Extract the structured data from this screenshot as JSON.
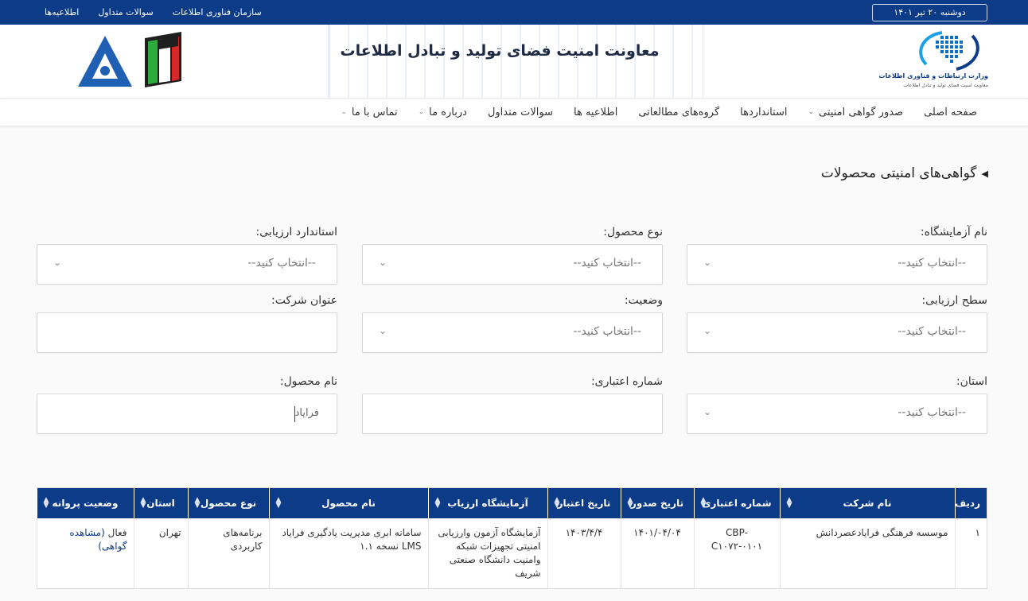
{
  "topbar": {
    "date": "دوشنبه ۲۰ تیر ۱۴۰۱",
    "links": [
      "اطلاعیه‌ها",
      "سوالات متداول",
      "سازمان فناوری اطلاعات"
    ]
  },
  "header": {
    "banner_title": "معاونت امنیت فضای تولید و تبادل اطلاعات",
    "ministry_name": "وزارت ارتباطات و فناوری اطلاعات",
    "ministry_sub": "معاونت امنیت فضای تولید و تبادل اطلاعات"
  },
  "nav": {
    "items": [
      {
        "label": "صفحه اصلی",
        "dropdown": false
      },
      {
        "label": "صدور گواهی امنیتی",
        "dropdown": true
      },
      {
        "label": "استانداردها",
        "dropdown": false
      },
      {
        "label": "گروه‌های مطالعاتی",
        "dropdown": false
      },
      {
        "label": "اطلاعیه ها",
        "dropdown": false
      },
      {
        "label": "سوالات متداول",
        "dropdown": false
      },
      {
        "label": "درباره ما",
        "dropdown": true
      },
      {
        "label": "تماس با ما",
        "dropdown": true
      }
    ]
  },
  "page": {
    "title": "گواهی‌های امنیتی محصولات"
  },
  "form": {
    "select_placeholder": "--انتخاب کنید--",
    "lab_label": "نام آزمایشگاه:",
    "product_type_label": "نوع محصول:",
    "standard_label": "استاندارد ارزیابی:",
    "level_label": "سطح ارزیابی:",
    "status_label": "وضعیت:",
    "company_label": "عنوان شرکت:",
    "province_label": "استان:",
    "cert_number_label": "شماره اعتباری:",
    "product_name_label": "نام محصول:",
    "company_value": "",
    "cert_number_value": "",
    "product_name_value": "فراياد"
  },
  "table": {
    "headers": [
      "ردیف",
      "نام شرکت",
      "شماره اعتباری",
      "تاریخ صدور",
      "تاریخ اعتبار",
      "آزمایشگاه ارزیاب",
      "نام محصول",
      "نوع محصول",
      "استان",
      "وضعیت پروانه"
    ],
    "rows": [
      {
        "index": "۱",
        "company": "موسسه فرهنگی فرايادعصردانش",
        "cert_number": "CBP-C۱۰۷۲-۰۱۰۱",
        "issue_date": "۱۴۰۱/۰۴/۰۴",
        "expiry_date": "۱۴۰۳/۴/۴",
        "lab": "آزمایشگاه آزمون وارزیابی امنیتی تجهیزات شبکه وامنیت دانشگاه صنعتی شریف",
        "product_name": "سامانه ابری مدیریت یادگیری فراياد LMS نسخه ۱.۱",
        "product_type": "برنامه‌های کاربردی",
        "province": "تهران",
        "status": "فعال",
        "status_link": "(مشاهده گواهی)"
      }
    ]
  },
  "colors": {
    "primary": "#0c3b87",
    "background": "#fafafa"
  }
}
